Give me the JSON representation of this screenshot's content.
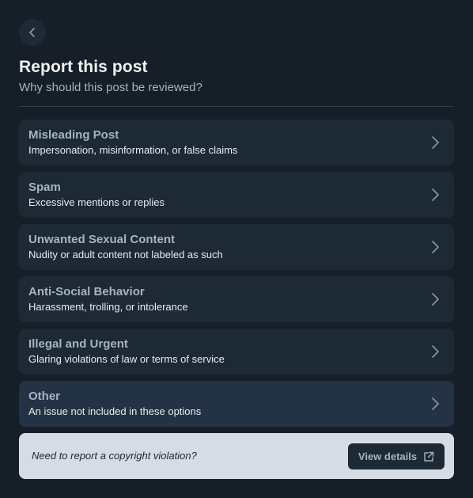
{
  "dialog": {
    "title": "Report this post",
    "subtitle": "Why should this post be reviewed?"
  },
  "options": [
    {
      "title": "Misleading Post",
      "description": "Impersonation, misinformation, or false claims"
    },
    {
      "title": "Spam",
      "description": "Excessive mentions or replies"
    },
    {
      "title": "Unwanted Sexual Content",
      "description": "Nudity or adult content not labeled as such"
    },
    {
      "title": "Anti-Social Behavior",
      "description": "Harassment, trolling, or intolerance"
    },
    {
      "title": "Illegal and Urgent",
      "description": "Glaring violations of law or terms of service"
    },
    {
      "title": "Other",
      "description": "An issue not included in these options"
    }
  ],
  "copyright": {
    "text": "Need to report a copyright violation?",
    "button_label": "View details"
  },
  "icons": {
    "back": "chevron-left-icon",
    "option": "chevron-right-icon",
    "external": "external-link-icon"
  },
  "colors": {
    "background": "#161e27",
    "card": "#1e2936",
    "muted_text": "#a7b3c1",
    "notice_background": "#d5dce4"
  }
}
